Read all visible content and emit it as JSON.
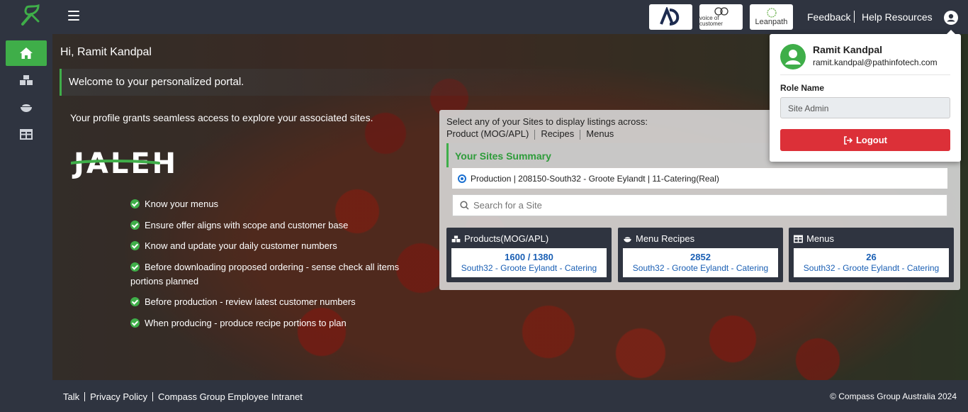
{
  "header": {
    "partners": [
      "AD",
      "voice of customer",
      "Leanpath"
    ],
    "feedback": "Feedback",
    "help": "Help Resources"
  },
  "sidebar": {
    "items": [
      {
        "icon": "home-icon",
        "active": true
      },
      {
        "icon": "boxes-icon",
        "active": false
      },
      {
        "icon": "bowl-icon",
        "active": false
      },
      {
        "icon": "table-icon",
        "active": false
      }
    ]
  },
  "main": {
    "greeting": "Hi, Ramit Kandpal",
    "welcome": "Welcome to your personalized portal.",
    "profile_text": "Your profile grants seamless access to explore your associated sites.",
    "brand": "JALEH",
    "features": [
      "Know your menus",
      "Ensure offer aligns with scope and customer base",
      "Know and update your daily customer numbers",
      "Before downloading proposed ordering - sense check all items portions planned",
      "Before production - review latest customer numbers",
      "When producing - produce recipe portions to plan"
    ]
  },
  "sites": {
    "intro": "Select any of your Sites to display listings across:",
    "links": [
      "Product (MOG/APL)",
      "Recipes",
      "Menus"
    ],
    "summary_title": "Your Sites Summary",
    "selected_site": "Production | 208150-South32 - Groote Eylandt | 11-Catering(Real)",
    "search_placeholder": "Search for a Site",
    "cards": [
      {
        "title": "Products(MOG/APL)",
        "value": "1600 / 1380",
        "site": "South32 - Groote Eylandt - Catering"
      },
      {
        "title": "Menu Recipes",
        "value": "2852",
        "site": "South32 - Groote Eylandt - Catering"
      },
      {
        "title": "Menus",
        "value": "26",
        "site": "South32 - Groote Eylandt - Catering"
      }
    ]
  },
  "user_menu": {
    "name": "Ramit Kandpal",
    "email": "ramit.kandpal@pathinfotech.com",
    "role_label": "Role Name",
    "role_value": "Site Admin",
    "logout": "Logout"
  },
  "footer": {
    "links": [
      "Talk",
      "Privacy Policy",
      "Compass Group Employee Intranet"
    ],
    "copyright": "© Compass Group Australia 2024"
  },
  "colors": {
    "accent_green": "#3fae49",
    "dark_bg": "#2f3440",
    "logout_red": "#dc3038",
    "link_blue": "#1a5fb4"
  }
}
